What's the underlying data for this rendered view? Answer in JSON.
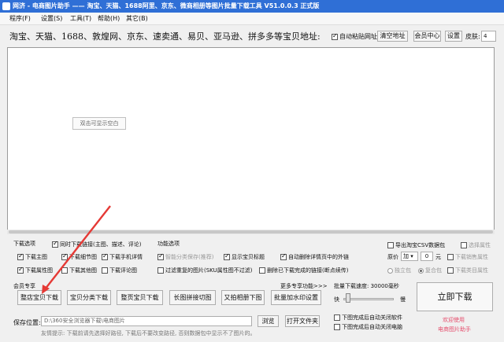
{
  "window": {
    "title": "网济 - 电商图片助手 —— 淘宝、天猫、1688阿里、京东、微商相册等图片批量下载工具 V51.0.0.3 正式版"
  },
  "menu": {
    "items": [
      "程序(F)",
      "设置(S)",
      "工具(T)",
      "帮助(H)",
      "其它(B)"
    ]
  },
  "address": {
    "label": "淘宝、天猫、1688、敦煌网、京东、速卖通、易贝、亚马逊、拼多多等宝贝地址:",
    "auto_paste_label": "自动粘贴网址",
    "clear_button": "清空地址",
    "member_button": "会员中心",
    "settings_button": "设置",
    "skin_label": "皮肤:",
    "skin_value": "4"
  },
  "main": {
    "empty_hint": "双击可显示空白"
  },
  "download_options": {
    "title": "下载选项",
    "items": [
      {
        "label": "同时下载链接(主图、描述、评论)",
        "checked": true,
        "disabled": false
      },
      {
        "label": "下载主图",
        "checked": true,
        "disabled": false
      },
      {
        "label": "下载细节图",
        "checked": true,
        "disabled": false
      },
      {
        "label": "下载手机详情",
        "checked": true,
        "disabled": false
      },
      {
        "label": "下载属性图",
        "checked": true,
        "disabled": false
      },
      {
        "label": "下载其他图",
        "checked": false,
        "disabled": false
      },
      {
        "label": "下载评论图",
        "checked": false,
        "disabled": false
      }
    ]
  },
  "function_options": {
    "title": "功能选项",
    "items": [
      {
        "label": "智能分类保存(推荐)",
        "checked": true,
        "disabled": true
      },
      {
        "label": "显示宝贝标题",
        "checked": true,
        "disabled": false
      },
      {
        "label": "自动删除详情页中的外链",
        "checked": true,
        "disabled": false
      },
      {
        "label": "过滤重复的图片(SKU属性图不过滤)",
        "checked": false,
        "disabled": false
      },
      {
        "label": "删除已下载完成的链接(断点续传)",
        "checked": false,
        "disabled": false
      }
    ]
  },
  "csv_options": {
    "export_label": "导出淘宝CSV数据包",
    "select_attr_label": "选择属性",
    "price_label": "原价",
    "price_op": "加",
    "price_value": "0",
    "price_unit": "元",
    "sales_attr_label": "下载销售属性",
    "single_pack": "独立包",
    "combo_pack": "复合包",
    "category_attr_label": "下载类目属性"
  },
  "member_panel": {
    "title": "会员专享",
    "more_label": "更多专享功能>>>",
    "buttons": [
      "整店宝贝下载",
      "宝贝分类下载",
      "整页宝贝下载",
      "长图拼接切图",
      "又拍相册下图",
      "批量加水印设置"
    ]
  },
  "speed": {
    "label": "批量下载速度: 30000毫秒",
    "fast": "快",
    "slow": "慢",
    "slider_fraction": 0.05
  },
  "start_button": "立即下载",
  "after_options": [
    "下图完成后自动关闭软件",
    "下图完成后自动关闭电脑"
  ],
  "promo": {
    "line1": "欢迎使用",
    "line2": "电商图片助手"
  },
  "save": {
    "label": "保存位置:",
    "path": "D:\\360安全浏览器下载\\电商图片",
    "browse_button": "浏览",
    "open_button": "打开文件夹"
  },
  "tip": "友情提示: 下载前请先选择好路径, 下载后不要改变路径, 否则数据包中显示不了图片的。",
  "colors": {
    "titlebar": "#2f6fd6",
    "promo": "#e54d6c",
    "arrow": "#e53935"
  }
}
